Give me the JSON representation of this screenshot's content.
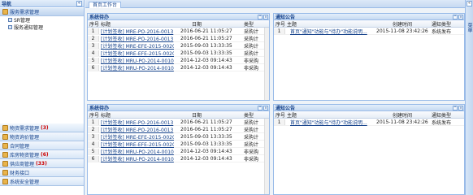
{
  "sidebar": {
    "title": "导航",
    "collapse": "«",
    "top_groups": [
      {
        "label": "服务需求管理",
        "children": [
          "SR管理",
          "服务通知管理"
        ]
      }
    ],
    "bottom_groups": [
      {
        "label": "物资需求管理",
        "count": "(3)"
      },
      {
        "label": "物资询价管理",
        "count": ""
      },
      {
        "label": "合同管理",
        "count": ""
      },
      {
        "label": "库房物资管理",
        "count": "(6)"
      },
      {
        "label": "供应商管理",
        "count": "(33)"
      },
      {
        "label": "财务接口",
        "count": ""
      },
      {
        "label": "系统安全管理",
        "count": ""
      }
    ]
  },
  "main": {
    "tab": "首页工作台",
    "todo_panels": [
      {
        "title": "系统待办",
        "columns": [
          "序号",
          "标题",
          "日期",
          "类型"
        ],
        "rows": [
          {
            "idx": "1",
            "title": "[计划签收] MRE-PO-2016-0013",
            "date": "2016-06-21 11:05:27",
            "type": "采购计"
          },
          {
            "idx": "2",
            "title": "[计划签收] MRE-PO-2016-0013",
            "date": "2016-06-21 11:05:27",
            "type": "采购计"
          },
          {
            "idx": "3",
            "title": "[计划签收] MRE-EFE-2015-0020",
            "date": "2015-09-03 13:33:35",
            "type": "采购计"
          },
          {
            "idx": "4",
            "title": "[计划签收] MRE-EFE-2015-0020",
            "date": "2015-09-03 13:33:35",
            "type": "采购计"
          },
          {
            "idx": "5",
            "title": "[计划签收] MRU-PO-2014-0010",
            "date": "2014-12-03 09:14:43",
            "type": "非采购"
          },
          {
            "idx": "6",
            "title": "[计划签收] MRU-PO-2014-0010",
            "date": "2014-12-03 09:14:43",
            "type": "非采购"
          }
        ]
      },
      {
        "title": "系统待办",
        "columns": [
          "序号",
          "标题",
          "日期",
          "类型"
        ],
        "rows": [
          {
            "idx": "1",
            "title": "[计划签收] MRE-PO-2016-0013",
            "date": "2016-06-21 11:05:27",
            "type": "采购计"
          },
          {
            "idx": "2",
            "title": "[计划签收] MRE-PO-2016-0013",
            "date": "2016-06-21 11:05:27",
            "type": "采购计"
          },
          {
            "idx": "3",
            "title": "[计划签收] MRE-EFE-2015-0020",
            "date": "2015-09-03 13:33:35",
            "type": "采购计"
          },
          {
            "idx": "4",
            "title": "[计划签收] MRE-EFE-2015-0020",
            "date": "2015-09-03 13:33:35",
            "type": "采购计"
          },
          {
            "idx": "5",
            "title": "[计划签收] MRU-PO-2014-0010",
            "date": "2014-12-03 09:14:43",
            "type": "非采购"
          },
          {
            "idx": "6",
            "title": "[计划签收] MRU-PO-2014-0010",
            "date": "2014-12-03 09:14:43",
            "type": "非采购"
          }
        ]
      }
    ],
    "notice_panels": [
      {
        "title": "通知公告",
        "columns": [
          "序号",
          "主题",
          "创建时间",
          "通知类型"
        ],
        "rows": [
          {
            "idx": "1",
            "title": "首页\"通知\"功能与\"待办\"功能说明...",
            "date": "2015-11-08 23:42:26",
            "type": "系统发布"
          }
        ]
      },
      {
        "title": "通知公告",
        "columns": [
          "序号",
          "主题",
          "创建时间",
          "通知类型"
        ],
        "rows": [
          {
            "idx": "1",
            "title": "首页\"通知\"功能与\"待办\"功能说明...",
            "date": "2015-11-08 23:42:26",
            "type": "系统发布"
          }
        ]
      }
    ]
  },
  "right_strip": {
    "label": "菜单",
    "arrow": "«"
  }
}
